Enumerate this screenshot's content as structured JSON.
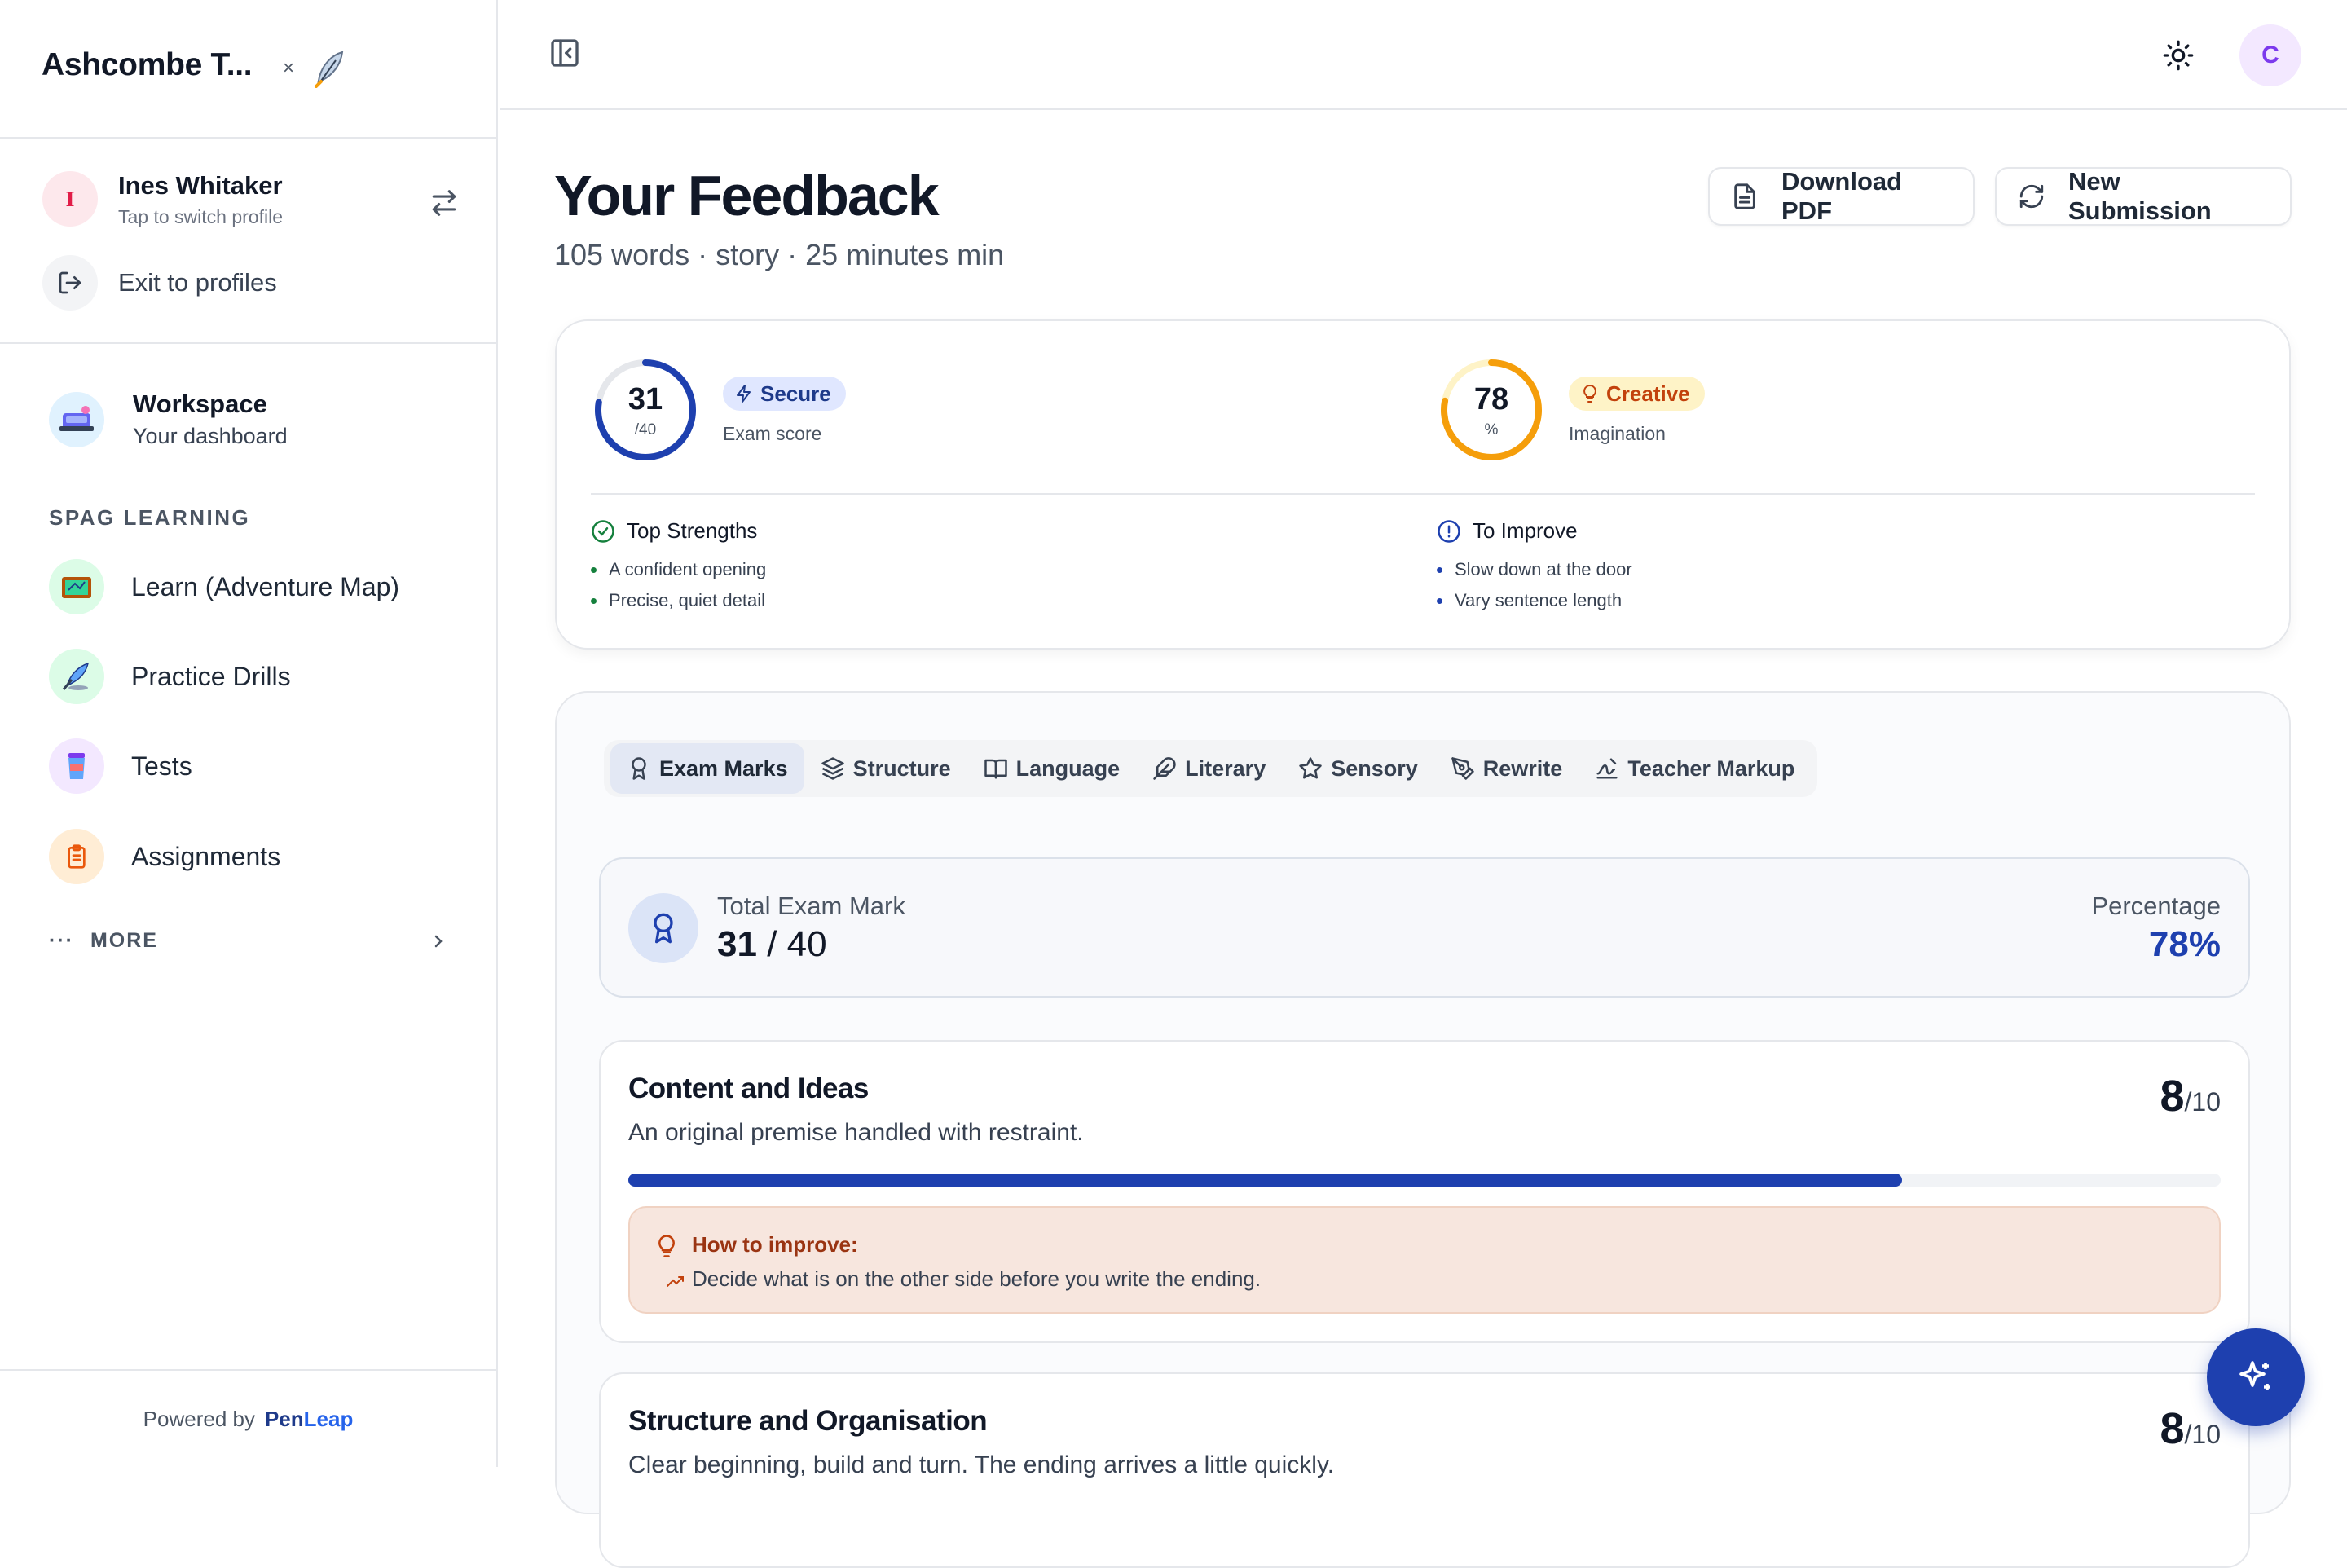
{
  "sidebar": {
    "org_title": "Ashcombe T...",
    "org_close": "×",
    "profile": {
      "initial": "I",
      "name": "Ines Whitaker",
      "subtitle": "Tap to switch profile"
    },
    "exit_label": "Exit to profiles",
    "workspace": {
      "title": "Workspace",
      "subtitle": "Your dashboard"
    },
    "section_label": "SPAG LEARNING",
    "items": [
      {
        "label": "Learn (Adventure Map)",
        "icon": "map-icon"
      },
      {
        "label": "Practice Drills",
        "icon": "quill-icon"
      },
      {
        "label": "Tests",
        "icon": "cup-icon"
      },
      {
        "label": "Assignments",
        "icon": "clipboard-icon"
      }
    ],
    "more_label": "MORE",
    "footer": {
      "prefix": "Powered by",
      "brand_a": "Pen",
      "brand_b": "Leap"
    }
  },
  "topbar": {
    "user_initial": "C"
  },
  "header": {
    "title": "Your Feedback",
    "subtitle": "105 words · story · 25 minutes min",
    "download_label": "Download PDF",
    "new_label": "New Submission"
  },
  "summary": {
    "exam": {
      "score": "31",
      "sub": "/40",
      "fraction": 0.775,
      "badge": "Secure",
      "caption": "Exam score"
    },
    "imagination": {
      "score": "78",
      "sub": "%",
      "fraction": 0.78,
      "badge": "Creative",
      "caption": "Imagination"
    },
    "strengths": {
      "title": "Top Strengths",
      "items": [
        "A confident opening",
        "Precise, quiet detail"
      ]
    },
    "improve": {
      "title": "To Improve",
      "items": [
        "Slow down at the door",
        "Vary sentence length"
      ]
    }
  },
  "tabs": [
    "Exam Marks",
    "Structure",
    "Language",
    "Literary",
    "Sensory",
    "Rewrite",
    "Teacher Markup"
  ],
  "total": {
    "label": "Total Exam Mark",
    "score": "31",
    "max": "/ 40",
    "pct_label": "Percentage",
    "pct_value": "78%"
  },
  "criteria": [
    {
      "title": "Content and Ideas",
      "desc": "An original premise handled with restraint.",
      "score": "8",
      "max": "/10",
      "fraction": 0.8,
      "hint_title": "How to improve:",
      "hint": "Decide what is on the other side before you write the ending."
    },
    {
      "title": "Structure and Organisation",
      "desc": "Clear beginning, build and turn. The ending arrives a little quickly.",
      "score": "8",
      "max": "/10"
    }
  ],
  "colors": {
    "accent": "#1e40af",
    "amber": "#f59e0b",
    "badge_blue": "#e0e7ff",
    "badge_amber": "#fef3c7",
    "green": "#15803d"
  }
}
